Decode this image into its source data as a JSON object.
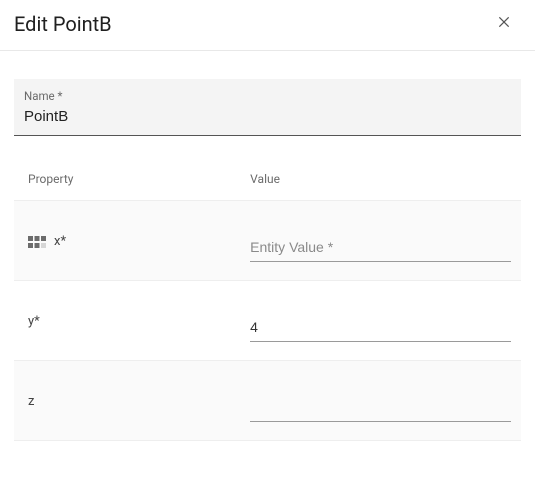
{
  "header": {
    "title": "Edit PointB"
  },
  "name_field": {
    "label": "Name *",
    "value": "PointB"
  },
  "table": {
    "headers": {
      "property": "Property",
      "value": "Value"
    },
    "rows": [
      {
        "has_icon": true,
        "icon": "grid-cards-icon",
        "property": "x*",
        "value": "",
        "placeholder": "Entity Value *"
      },
      {
        "has_icon": false,
        "property": "y*",
        "value": "4",
        "placeholder": ""
      },
      {
        "has_icon": false,
        "property": "z",
        "value": "",
        "placeholder": ""
      }
    ]
  }
}
